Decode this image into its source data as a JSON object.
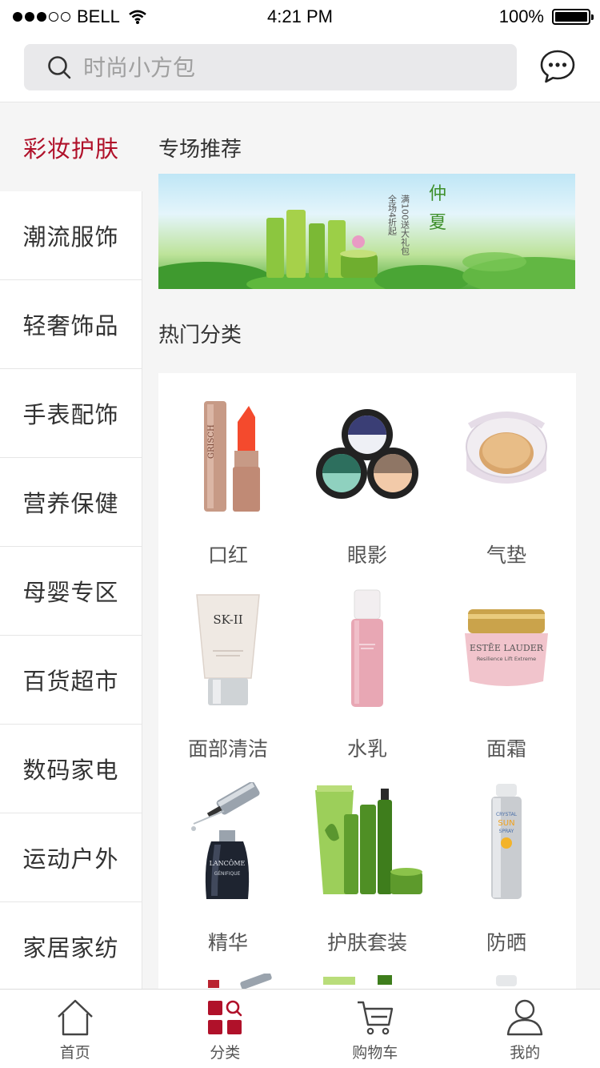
{
  "status_bar": {
    "carrier": "BELL",
    "time": "4:21 PM",
    "battery": "100%"
  },
  "search": {
    "placeholder": "时尚小方包"
  },
  "sidebar": {
    "items": [
      {
        "label": "彩妆护肤",
        "active": true
      },
      {
        "label": "潮流服饰"
      },
      {
        "label": "轻奢饰品"
      },
      {
        "label": "手表配饰"
      },
      {
        "label": "营养保健"
      },
      {
        "label": "母婴专区"
      },
      {
        "label": "百货超市"
      },
      {
        "label": "数码家电"
      },
      {
        "label": "运动户外"
      },
      {
        "label": "家居家纺"
      }
    ]
  },
  "main": {
    "featured_title": "专场推荐",
    "banner": {
      "title": "仲夏",
      "line1": "满 100 送大礼包",
      "line2": "全场 4 折起"
    },
    "hot_title": "热门分类",
    "categories": [
      {
        "label": "口红",
        "icon": "lipstick-icon"
      },
      {
        "label": "眼影",
        "icon": "eyeshadow-icon"
      },
      {
        "label": "气垫",
        "icon": "cushion-icon"
      },
      {
        "label": "面部清洁",
        "icon": "cleanser-icon"
      },
      {
        "label": "水乳",
        "icon": "toner-icon"
      },
      {
        "label": "面霜",
        "icon": "cream-icon"
      },
      {
        "label": "精华",
        "icon": "serum-icon"
      },
      {
        "label": "护肤套装",
        "icon": "skincare-set-icon"
      },
      {
        "label": "防晒",
        "icon": "sunscreen-icon"
      }
    ],
    "product_texts": {
      "cleanser_brand": "SK-II",
      "cream_brand": "ESTĒE LAUDER",
      "cream_line": "Resilience Lift Extreme",
      "serum_brand": "LANCÔME",
      "serum_line": "GÉNIFIQUE",
      "sunscreen_line1": "CRYSTAL",
      "sunscreen_line2": "SUN",
      "sunscreen_line3": "SPRAY"
    }
  },
  "tabbar": {
    "items": [
      {
        "label": "首页",
        "icon": "home-icon"
      },
      {
        "label": "分类",
        "icon": "category-icon",
        "active": true
      },
      {
        "label": "购物车",
        "icon": "cart-icon"
      },
      {
        "label": "我的",
        "icon": "profile-icon"
      }
    ]
  },
  "colors": {
    "accent": "#b0112a",
    "banner_green": "#4fa83a"
  }
}
